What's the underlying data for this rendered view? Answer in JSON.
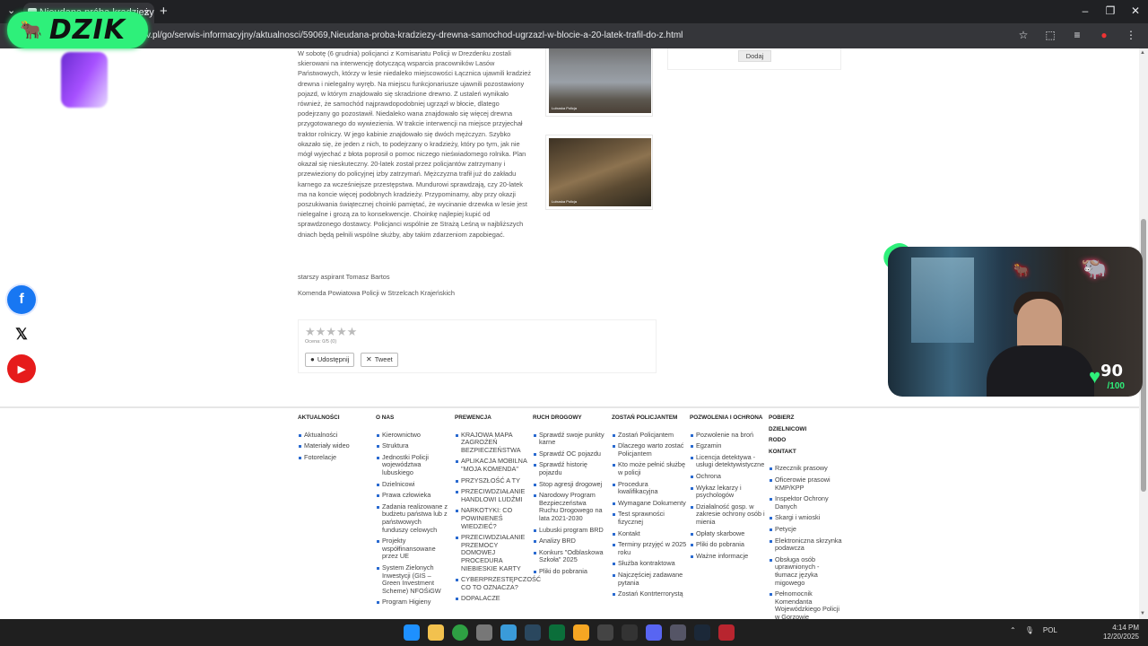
{
  "browser": {
    "tab_title": "Nieudana próba kradzieży drew",
    "url": "v.pl/go/serwis-informacyjny/aktualnosci/59069,Nieudana-proba-kradziezy-drewna-samochod-ugrzazl-w-blocie-a-20-latek-trafil-do-z.html",
    "new_tab": "+",
    "close_tab": "×",
    "tab_search": "⌄",
    "window_controls": [
      "–",
      "❐",
      "✕"
    ],
    "addr_icons": [
      "☆",
      "⬚",
      "≡",
      "●",
      "⋮"
    ]
  },
  "overlay": {
    "brand_name": "DZIK",
    "brand_icon": "bull-icon",
    "stream_score": "90",
    "stream_score_max": "/100",
    "brand_color": "#2ef07a"
  },
  "article": {
    "paragraph": "W sobotę (6 grudnia) policjanci z Komisariatu Policji w Drezdenku zostali skierowani na interwencję dotyczącą wsparcia pracowników Lasów Państwowych, którzy w lesie niedaleko miejscowości Łącznica ujawnili kradzież drewna i nielegalny wyręb. Na miejscu funkcjonariusze ujawnili pozostawiony pojazd, w którym znajdowało się skradzione drewno. Z ustaleń wynikało również, że samochód najprawdopodobniej ugrzązł w błocie, dlatego podejrzany go pozostawił. Niedaleko wana znajdowało się więcej drewna przygotowanego do wywiezienia. W trakcie interwencji na miejsce przyjechał traktor rolniczy. W jego kabinie znajdowało się dwóch mężczyzn. Szybko okazało się, że jeden z nich, to podejrzany o kradzieży, który po tym, jak nie mógł wyjechać z błota poprosił o pomoc niczego nieświadomego rolnika. Plan okazał się nieskuteczny. 20-latek został przez policjantów zatrzymany i przewieziony do policyjnej izby zatrzymań. Mężczyzna trafił już do zakładu karnego za wcześniejsze przestępstwa. Mundurowi sprawdzają, czy 20-latek ma na koncie więcej podobnych kradzieży. Przypominamy, aby przy okazji poszukiwania świątecznej choinki pamiętać, że wycinanie drzewka w lesie jest nielegalne i grozą za to konsekwencje. Choinkę najlepiej kupić od sprawdzonego dostawcy. Policjanci wspólnie ze Strażą Leśną w najbliższych dniach będą pełnili wspólne służby, aby takim zdarzeniom zapobiegać.",
    "author": "starszy aspirant Tomasz Bartos",
    "unit": "Komenda Powiatowa Policji w Strzelcach Krajeńskich",
    "photo1_caption": "Lubuska Policja",
    "photo2_caption": "Lubuska Policja",
    "dodaj": "Dodaj"
  },
  "rating": {
    "stars": "★★★★★",
    "score_text": "Ocena: 0/5 (0)",
    "share_fb": "Udostępnij",
    "share_x": "Tweet"
  },
  "footer": {
    "col1": {
      "title": "AKTUALNOŚCI",
      "items": [
        "Aktualności",
        "Materiały wideo",
        "Fotorelacje"
      ]
    },
    "col2": {
      "title": "O NAS",
      "items": [
        "Kierownictwo",
        "Struktura",
        "Jednostki Policji województwa lubuskiego",
        "Dzielnicowi",
        "Prawa człowieka",
        "Zadania realizowane z budżetu państwa lub z państwowych funduszy celowych",
        "Projekty współfinansowane przez UE",
        "System Zielonych Inwestycji (GIS – Green Investment Scheme) NFOŚiGW",
        "Program Higieny"
      ]
    },
    "col3": {
      "title": "PREWENCJA",
      "items": [
        "KRAJOWA MAPA ZAGROŻEŃ BEZPIECZEŃSTWA",
        "APLIKACJA MOBILNA \"MOJA KOMENDA\"",
        "PRZYSZŁOŚĆ A TY",
        "PRZECIWDZIAŁANIE HANDLOWI LUDŹMI",
        "NARKOTYKI: CO POWINIENEŚ WIEDZIEĆ?",
        "PRZECIWDZIAŁANIE PRZEMOCY DOMOWEJ PROCEDURA NIEBIESKIE KARTY",
        "CYBERPRZESTĘPCZOŚĆ CO TO OZNACZA?",
        "DOPALACZE"
      ]
    },
    "col4": {
      "title": "RUCH DROGOWY",
      "items": [
        "Sprawdź swoje punkty karne",
        "Sprawdź OC pojazdu",
        "Sprawdź historię pojazdu",
        "Stop agresji drogowej",
        "Narodowy Program Bezpieczeństwa Ruchu Drogowego na lata 2021-2030",
        "Lubuski program BRD",
        "Analizy BRD",
        "Konkurs \"Odblaskowa Szkoła\" 2025",
        "Pliki do pobrania"
      ]
    },
    "col5": {
      "title": "ZOSTAŃ POLICJANTEM",
      "items": [
        "Zostań Policjantem",
        "Dlaczego warto zostać Policjantem",
        "Kto może pełnić służbę w policji",
        "Procedura kwalifikacyjna",
        "Wymagane Dokumenty",
        "Test sprawności fizycznej",
        "Kontakt",
        "Terminy przyjęć w 2025 roku",
        "Służba kontraktowa",
        "Najczęściej zadawane pytania",
        "Zostań Kontrterrorystą"
      ]
    },
    "col6": {
      "title": "POZWOLENIA I OCHRONA",
      "items": [
        "Pozwolenie na broń",
        "Egzamin",
        "Licencja detektywa - usługi detektywistyczne",
        "Ochrona",
        "Wykaz lekarzy i psychologów",
        "Działalność gosp. w zakresie ochrony osób i mienia",
        "Opłaty skarbowe",
        "Pliki do pobrania",
        "Ważne informacje"
      ]
    },
    "col7": {
      "title": "POBIERZ",
      "bold_items": [
        "DZIELNICOWI",
        "RODO",
        "KONTAKT"
      ],
      "items": [
        "Rzecznik prasowy",
        "Oficerowie prasowi KMP/KPP",
        "Inspektor Ochrony Danych",
        "Skargi i wnioski",
        "Petycje",
        "Elektroniczna skrzynka podawcza",
        "Obsługa osób uprawnionych - tłumacz języka migowego",
        "Pełnomocnik Komendanta Wojewódzkiego Policji w Gorzowie"
      ]
    }
  },
  "social": {
    "facebook": "f",
    "x": "𝕏",
    "youtube": "▶"
  },
  "taskbar": {
    "tray_lang": "POL",
    "time": "4:14 PM",
    "date": "12/20/2025",
    "tray_up": "⌃",
    "tray_mic": "🎙"
  }
}
